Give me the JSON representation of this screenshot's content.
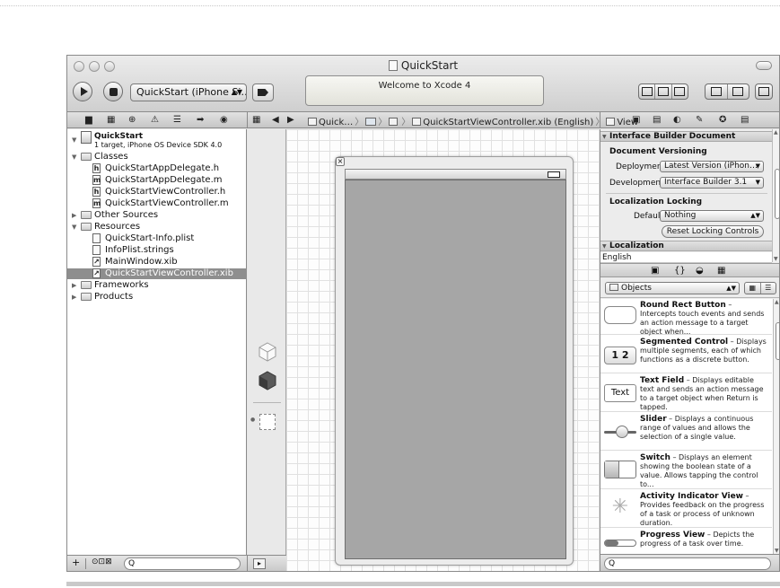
{
  "window": {
    "title": "QuickStart"
  },
  "toolbar": {
    "scheme_label": "QuickStart (iPhone Si…",
    "activity_message": "Welcome to Xcode 4"
  },
  "jumpbar": {
    "project_label": "Quick…",
    "file_label": "QuickStartViewController.xib (English)",
    "view_label": "View"
  },
  "navigator": {
    "project": {
      "name": "QuickStart",
      "subtitle": "1 target, iPhone OS Device SDK 4.0"
    },
    "items": [
      {
        "label": "Classes",
        "type": "group",
        "expanded": true
      },
      {
        "label": "QuickStartAppDelegate.h",
        "type": "h"
      },
      {
        "label": "QuickStartAppDelegate.m",
        "type": "m"
      },
      {
        "label": "QuickStartViewController.h",
        "type": "h"
      },
      {
        "label": "QuickStartViewController.m",
        "type": "m"
      },
      {
        "label": "Other Sources",
        "type": "group",
        "expanded": false
      },
      {
        "label": "Resources",
        "type": "group",
        "expanded": true
      },
      {
        "label": "QuickStart-Info.plist",
        "type": "file"
      },
      {
        "label": "InfoPlist.strings",
        "type": "file"
      },
      {
        "label": "MainWindow.xib",
        "type": "xib"
      },
      {
        "label": "QuickStartViewController.xib",
        "type": "xib",
        "selected": true
      },
      {
        "label": "Frameworks",
        "type": "group",
        "expanded": false
      },
      {
        "label": "Products",
        "type": "group",
        "expanded": false
      }
    ],
    "footer": {
      "plus": "+",
      "filters": "⊙⊡⊠",
      "search_placeholder": "Q"
    }
  },
  "inspector": {
    "ib_document": {
      "header": "Interface Builder Document",
      "versioning_title": "Document Versioning",
      "deployment_label": "Deployment",
      "deployment_value": "Latest Version (iPhon…",
      "development_label": "Development",
      "development_value": "Interface Builder 3.1"
    },
    "localization_locking": {
      "title": "Localization Locking",
      "default_label": "Default",
      "default_value": "Nothing",
      "reset_button": "Reset Locking Controls"
    },
    "localization": {
      "header": "Localization",
      "language": "English"
    }
  },
  "library": {
    "filter_label": "Objects",
    "search_placeholder": "Q",
    "items": [
      {
        "icon": "round-rect-button-icon",
        "name": "Round Rect Button",
        "desc": " – Intercepts touch events and sends an action message to a target object when..."
      },
      {
        "icon": "segmented-control-icon",
        "icon_text": "1 2",
        "name": "Segmented Control",
        "desc": " – Displays multiple segments, each of which functions as a discrete button."
      },
      {
        "icon": "text-field-icon",
        "icon_text": "Text",
        "name": "Text Field",
        "desc": " – Displays editable text and sends an action message to a target object when Return is tapped."
      },
      {
        "icon": "slider-icon",
        "name": "Slider",
        "desc": " – Displays a continuous range of values and allows the selection of a single value."
      },
      {
        "icon": "switch-icon",
        "name": "Switch",
        "desc": " – Displays an element showing the boolean state of a value. Allows tapping the control to..."
      },
      {
        "icon": "activity-indicator-icon",
        "name": "Activity Indicator View",
        "desc": " – Provides feedback on the progress of a task or process of unknown duration."
      },
      {
        "icon": "progress-view-icon",
        "name": "Progress View",
        "desc": " – Depicts the progress of a task over time."
      }
    ]
  },
  "colors": {
    "selection": "#8e8e8e",
    "view_fill": "#a6a6a6"
  }
}
